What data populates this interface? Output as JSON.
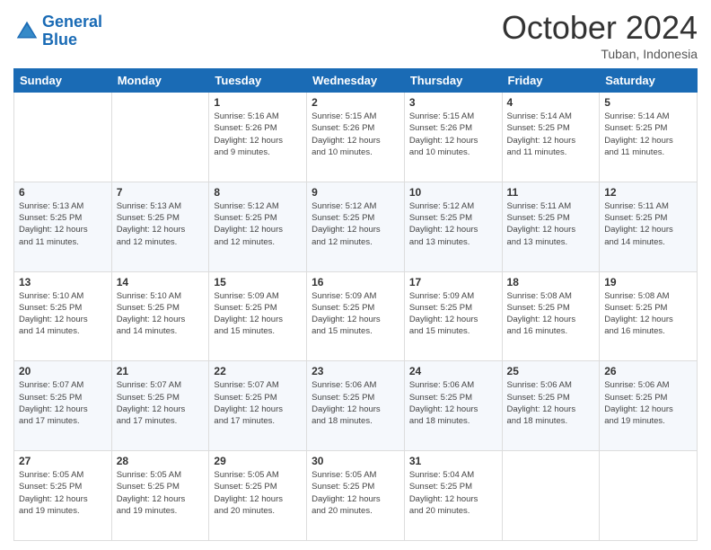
{
  "header": {
    "logo_line1": "General",
    "logo_line2": "Blue",
    "month": "October 2024",
    "location": "Tuban, Indonesia"
  },
  "columns": [
    "Sunday",
    "Monday",
    "Tuesday",
    "Wednesday",
    "Thursday",
    "Friday",
    "Saturday"
  ],
  "weeks": [
    [
      {
        "day": "",
        "info": ""
      },
      {
        "day": "",
        "info": ""
      },
      {
        "day": "1",
        "info": "Sunrise: 5:16 AM\nSunset: 5:26 PM\nDaylight: 12 hours\nand 9 minutes."
      },
      {
        "day": "2",
        "info": "Sunrise: 5:15 AM\nSunset: 5:26 PM\nDaylight: 12 hours\nand 10 minutes."
      },
      {
        "day": "3",
        "info": "Sunrise: 5:15 AM\nSunset: 5:26 PM\nDaylight: 12 hours\nand 10 minutes."
      },
      {
        "day": "4",
        "info": "Sunrise: 5:14 AM\nSunset: 5:25 PM\nDaylight: 12 hours\nand 11 minutes."
      },
      {
        "day": "5",
        "info": "Sunrise: 5:14 AM\nSunset: 5:25 PM\nDaylight: 12 hours\nand 11 minutes."
      }
    ],
    [
      {
        "day": "6",
        "info": "Sunrise: 5:13 AM\nSunset: 5:25 PM\nDaylight: 12 hours\nand 11 minutes."
      },
      {
        "day": "7",
        "info": "Sunrise: 5:13 AM\nSunset: 5:25 PM\nDaylight: 12 hours\nand 12 minutes."
      },
      {
        "day": "8",
        "info": "Sunrise: 5:12 AM\nSunset: 5:25 PM\nDaylight: 12 hours\nand 12 minutes."
      },
      {
        "day": "9",
        "info": "Sunrise: 5:12 AM\nSunset: 5:25 PM\nDaylight: 12 hours\nand 12 minutes."
      },
      {
        "day": "10",
        "info": "Sunrise: 5:12 AM\nSunset: 5:25 PM\nDaylight: 12 hours\nand 13 minutes."
      },
      {
        "day": "11",
        "info": "Sunrise: 5:11 AM\nSunset: 5:25 PM\nDaylight: 12 hours\nand 13 minutes."
      },
      {
        "day": "12",
        "info": "Sunrise: 5:11 AM\nSunset: 5:25 PM\nDaylight: 12 hours\nand 14 minutes."
      }
    ],
    [
      {
        "day": "13",
        "info": "Sunrise: 5:10 AM\nSunset: 5:25 PM\nDaylight: 12 hours\nand 14 minutes."
      },
      {
        "day": "14",
        "info": "Sunrise: 5:10 AM\nSunset: 5:25 PM\nDaylight: 12 hours\nand 14 minutes."
      },
      {
        "day": "15",
        "info": "Sunrise: 5:09 AM\nSunset: 5:25 PM\nDaylight: 12 hours\nand 15 minutes."
      },
      {
        "day": "16",
        "info": "Sunrise: 5:09 AM\nSunset: 5:25 PM\nDaylight: 12 hours\nand 15 minutes."
      },
      {
        "day": "17",
        "info": "Sunrise: 5:09 AM\nSunset: 5:25 PM\nDaylight: 12 hours\nand 15 minutes."
      },
      {
        "day": "18",
        "info": "Sunrise: 5:08 AM\nSunset: 5:25 PM\nDaylight: 12 hours\nand 16 minutes."
      },
      {
        "day": "19",
        "info": "Sunrise: 5:08 AM\nSunset: 5:25 PM\nDaylight: 12 hours\nand 16 minutes."
      }
    ],
    [
      {
        "day": "20",
        "info": "Sunrise: 5:07 AM\nSunset: 5:25 PM\nDaylight: 12 hours\nand 17 minutes."
      },
      {
        "day": "21",
        "info": "Sunrise: 5:07 AM\nSunset: 5:25 PM\nDaylight: 12 hours\nand 17 minutes."
      },
      {
        "day": "22",
        "info": "Sunrise: 5:07 AM\nSunset: 5:25 PM\nDaylight: 12 hours\nand 17 minutes."
      },
      {
        "day": "23",
        "info": "Sunrise: 5:06 AM\nSunset: 5:25 PM\nDaylight: 12 hours\nand 18 minutes."
      },
      {
        "day": "24",
        "info": "Sunrise: 5:06 AM\nSunset: 5:25 PM\nDaylight: 12 hours\nand 18 minutes."
      },
      {
        "day": "25",
        "info": "Sunrise: 5:06 AM\nSunset: 5:25 PM\nDaylight: 12 hours\nand 18 minutes."
      },
      {
        "day": "26",
        "info": "Sunrise: 5:06 AM\nSunset: 5:25 PM\nDaylight: 12 hours\nand 19 minutes."
      }
    ],
    [
      {
        "day": "27",
        "info": "Sunrise: 5:05 AM\nSunset: 5:25 PM\nDaylight: 12 hours\nand 19 minutes."
      },
      {
        "day": "28",
        "info": "Sunrise: 5:05 AM\nSunset: 5:25 PM\nDaylight: 12 hours\nand 19 minutes."
      },
      {
        "day": "29",
        "info": "Sunrise: 5:05 AM\nSunset: 5:25 PM\nDaylight: 12 hours\nand 20 minutes."
      },
      {
        "day": "30",
        "info": "Sunrise: 5:05 AM\nSunset: 5:25 PM\nDaylight: 12 hours\nand 20 minutes."
      },
      {
        "day": "31",
        "info": "Sunrise: 5:04 AM\nSunset: 5:25 PM\nDaylight: 12 hours\nand 20 minutes."
      },
      {
        "day": "",
        "info": ""
      },
      {
        "day": "",
        "info": ""
      }
    ]
  ]
}
